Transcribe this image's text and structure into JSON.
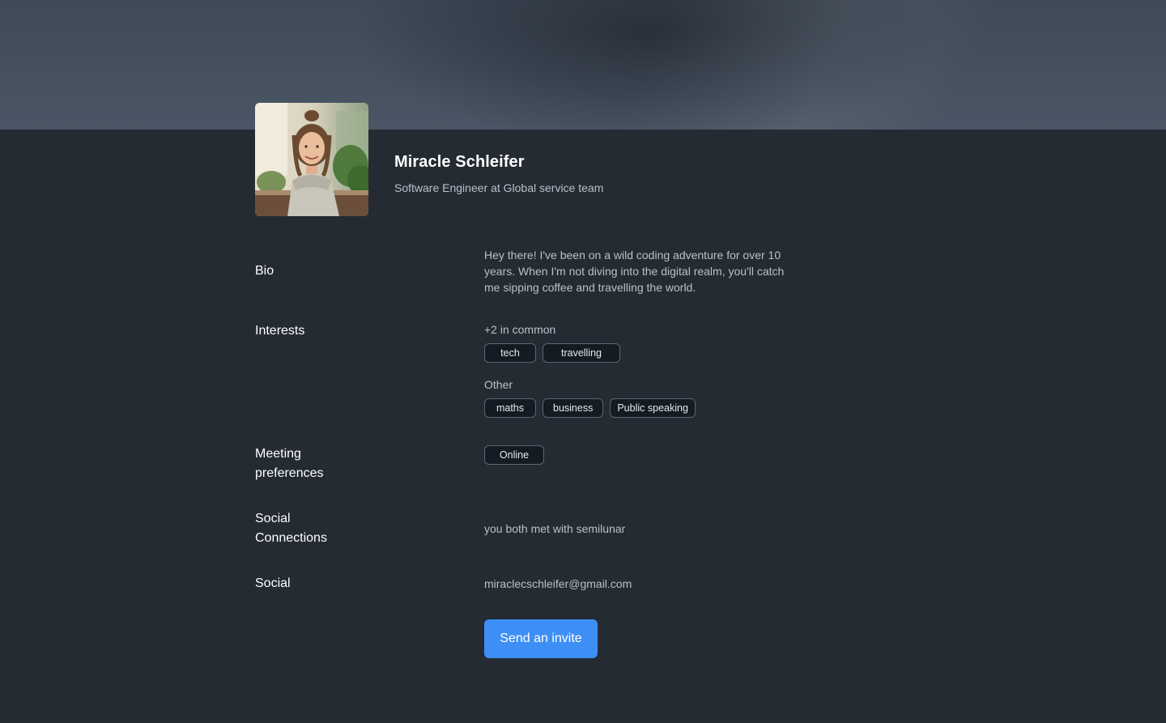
{
  "profile": {
    "name": "Miracle Schleifer",
    "title": "Software Engineer at Global service team"
  },
  "bio": {
    "label": "Bio",
    "text": "Hey there! I've been on a wild coding adventure for over 10 years. When I'm not diving into the digital realm, you'll catch me sipping coffee and travelling the world."
  },
  "interests": {
    "label": "Interests",
    "common_heading": "+2 in common",
    "common": [
      "tech",
      "travelling"
    ],
    "other_heading": "Other",
    "other": [
      "maths",
      "business",
      "Public speaking"
    ]
  },
  "meeting": {
    "label_line1": "Meeting",
    "label_line2": "preferences",
    "options": [
      "Online"
    ]
  },
  "social_connections": {
    "label_line1": "Social",
    "label_line2": "Connections",
    "text": "you both met with semilunar"
  },
  "social": {
    "label": "Social",
    "email": "miraclecschleifer@gmail.com"
  },
  "actions": {
    "invite_label": "Send an invite"
  },
  "colors": {
    "background": "#242b33",
    "accent": "#3d8ff5",
    "chip_background": "#151b22"
  }
}
